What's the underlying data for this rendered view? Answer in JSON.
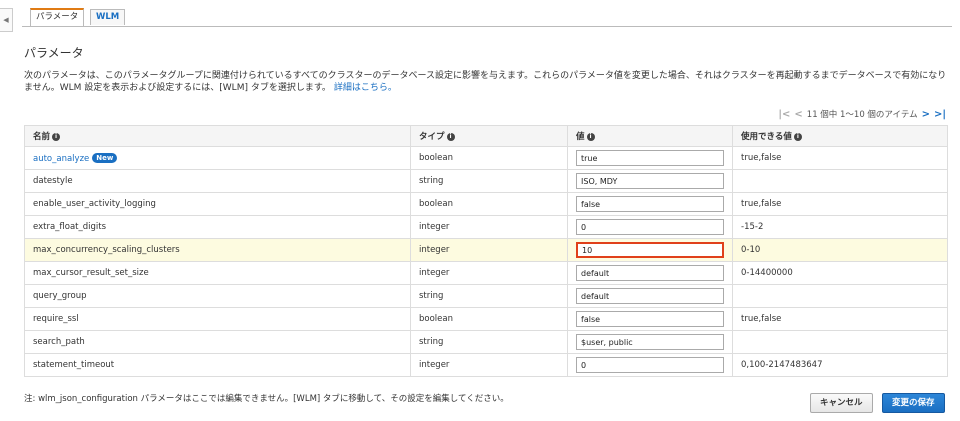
{
  "tabs": [
    {
      "label": "パラメータ"
    },
    {
      "label": "WLM"
    }
  ],
  "section": {
    "title": "パラメータ",
    "description": "次のパラメータは、このパラメータグループに関連付けられているすべてのクラスターのデータベース設定に影響を与えます。これらのパラメータ値を変更した場合、それはクラスターを再起動するまでデータベースで有効になりません。WLM 設定を表示および設定するには、[WLM] タブを選択します。",
    "learn_more": "詳細はこちら。"
  },
  "pager": {
    "text": "11 個中 1～10 個のアイテム"
  },
  "table": {
    "headers": {
      "name": "名前",
      "type": "タイプ",
      "value": "値",
      "allowed": "使用できる値"
    },
    "rows": [
      {
        "name": "auto_analyze",
        "badge": "New",
        "type": "boolean",
        "value": "true",
        "allowed": "true,false"
      },
      {
        "name": "datestyle",
        "type": "string",
        "value": "ISO, MDY",
        "allowed": ""
      },
      {
        "name": "enable_user_activity_logging",
        "type": "boolean",
        "value": "false",
        "allowed": "true,false"
      },
      {
        "name": "extra_float_digits",
        "type": "integer",
        "value": "0",
        "allowed": "-15-2"
      },
      {
        "name": "max_concurrency_scaling_clusters",
        "type": "integer",
        "value": "10",
        "allowed": "0-10"
      },
      {
        "name": "max_cursor_result_set_size",
        "type": "integer",
        "value": "default",
        "allowed": "0-14400000"
      },
      {
        "name": "query_group",
        "type": "string",
        "value": "default",
        "allowed": ""
      },
      {
        "name": "require_ssl",
        "type": "boolean",
        "value": "false",
        "allowed": "true,false"
      },
      {
        "name": "search_path",
        "type": "string",
        "value": "$user, public",
        "allowed": ""
      },
      {
        "name": "statement_timeout",
        "type": "integer",
        "value": "0",
        "allowed": "0,100-2147483647"
      }
    ]
  },
  "note": "注: wlm_json_configuration パラメータはここでは編集できません。[WLM] タブに移動して、その設定を編集してください。",
  "buttons": {
    "cancel": "キャンセル",
    "save": "変更の保存"
  }
}
